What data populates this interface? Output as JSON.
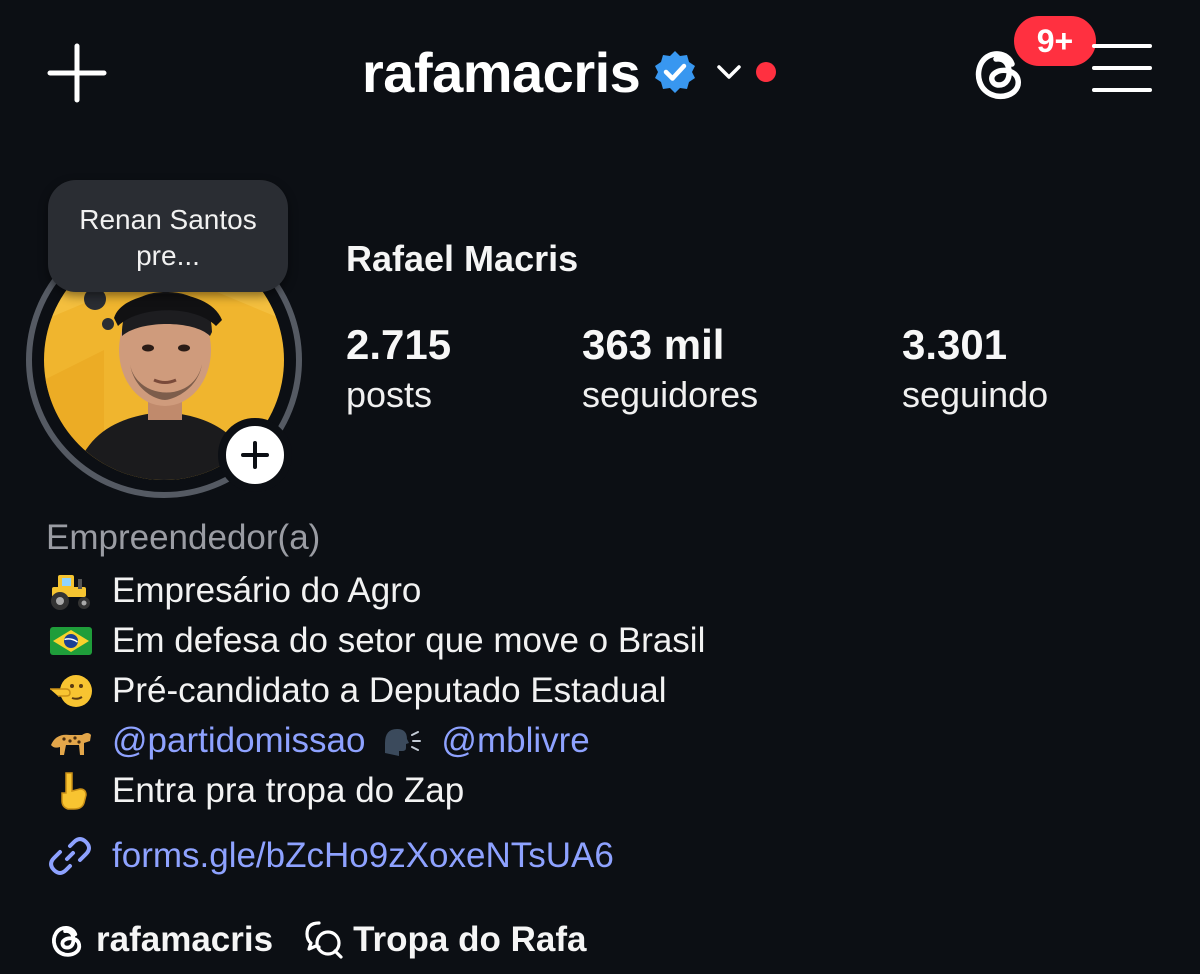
{
  "header": {
    "username": "rafamacris",
    "notification_count": "9+",
    "icons": [
      "plus-icon",
      "verified-badge-icon",
      "chevron-down-icon",
      "threads-icon",
      "menu-icon"
    ],
    "colors": {
      "background": "#0c0f14",
      "verified": "#3897f0",
      "badge": "#ff3040",
      "link": "#8ea2ff"
    }
  },
  "profile": {
    "note": "Renan Santos pre...",
    "full_name": "Rafael Macris",
    "stats": [
      {
        "value": "2.715",
        "label": "posts"
      },
      {
        "value": "363 mil",
        "label": "seguidores"
      },
      {
        "value": "3.301",
        "label": "seguindo"
      }
    ]
  },
  "bio": {
    "category": "Empreendedor(a)",
    "lines": [
      {
        "emoji": "tractor",
        "text": "Empresário do Agro"
      },
      {
        "emoji": "brazil-flag",
        "text": "Em defesa do setor que move o Brasil"
      },
      {
        "emoji": "pointing-face",
        "text": "Pré-candidato a Deputado Estadual"
      },
      {
        "emoji": "leopard",
        "mention1": "@partidomissao",
        "emoji2": "speaking-head",
        "mention2": "@mblivre"
      },
      {
        "emoji": "pointing-down-hand",
        "text": "Entra pra tropa do Zap"
      }
    ],
    "link": "forms.gle/bZcHo9zXoxeNTsUA6"
  },
  "bottom": {
    "threads_label": "rafamacris",
    "channel_label": "Tropa do Rafa"
  }
}
